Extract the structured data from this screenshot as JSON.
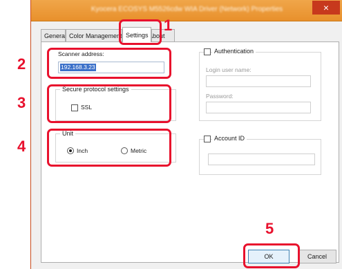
{
  "window": {
    "title": "Kyocera ECOSYS M5526cdw WIA Driver (Network) Properties",
    "close_label": "×"
  },
  "tabs": [
    {
      "label": "General"
    },
    {
      "label": "Color Management"
    },
    {
      "label": "Settings"
    },
    {
      "label": "About"
    }
  ],
  "scanner": {
    "label": "Scanner address:",
    "value": "192.168.3.23"
  },
  "secure": {
    "legend": "Secure protocol settings",
    "ssl_label": "SSL",
    "ssl_checked": false
  },
  "unit": {
    "legend": "Unit",
    "inch_label": "Inch",
    "metric_label": "Metric",
    "selected": "Inch"
  },
  "authentication": {
    "label": "Authentication",
    "checked": false,
    "login_label": "Login user name:",
    "password_label": "Password:"
  },
  "account": {
    "label": "Account ID",
    "checked": false
  },
  "buttons": {
    "ok": "OK",
    "cancel": "Cancel"
  },
  "callouts": [
    "1",
    "2",
    "3",
    "4",
    "5"
  ],
  "colors": {
    "callout": "#e8112d",
    "titlebar": "#e8902c",
    "close": "#c7391d",
    "selection": "#3b70c9"
  }
}
